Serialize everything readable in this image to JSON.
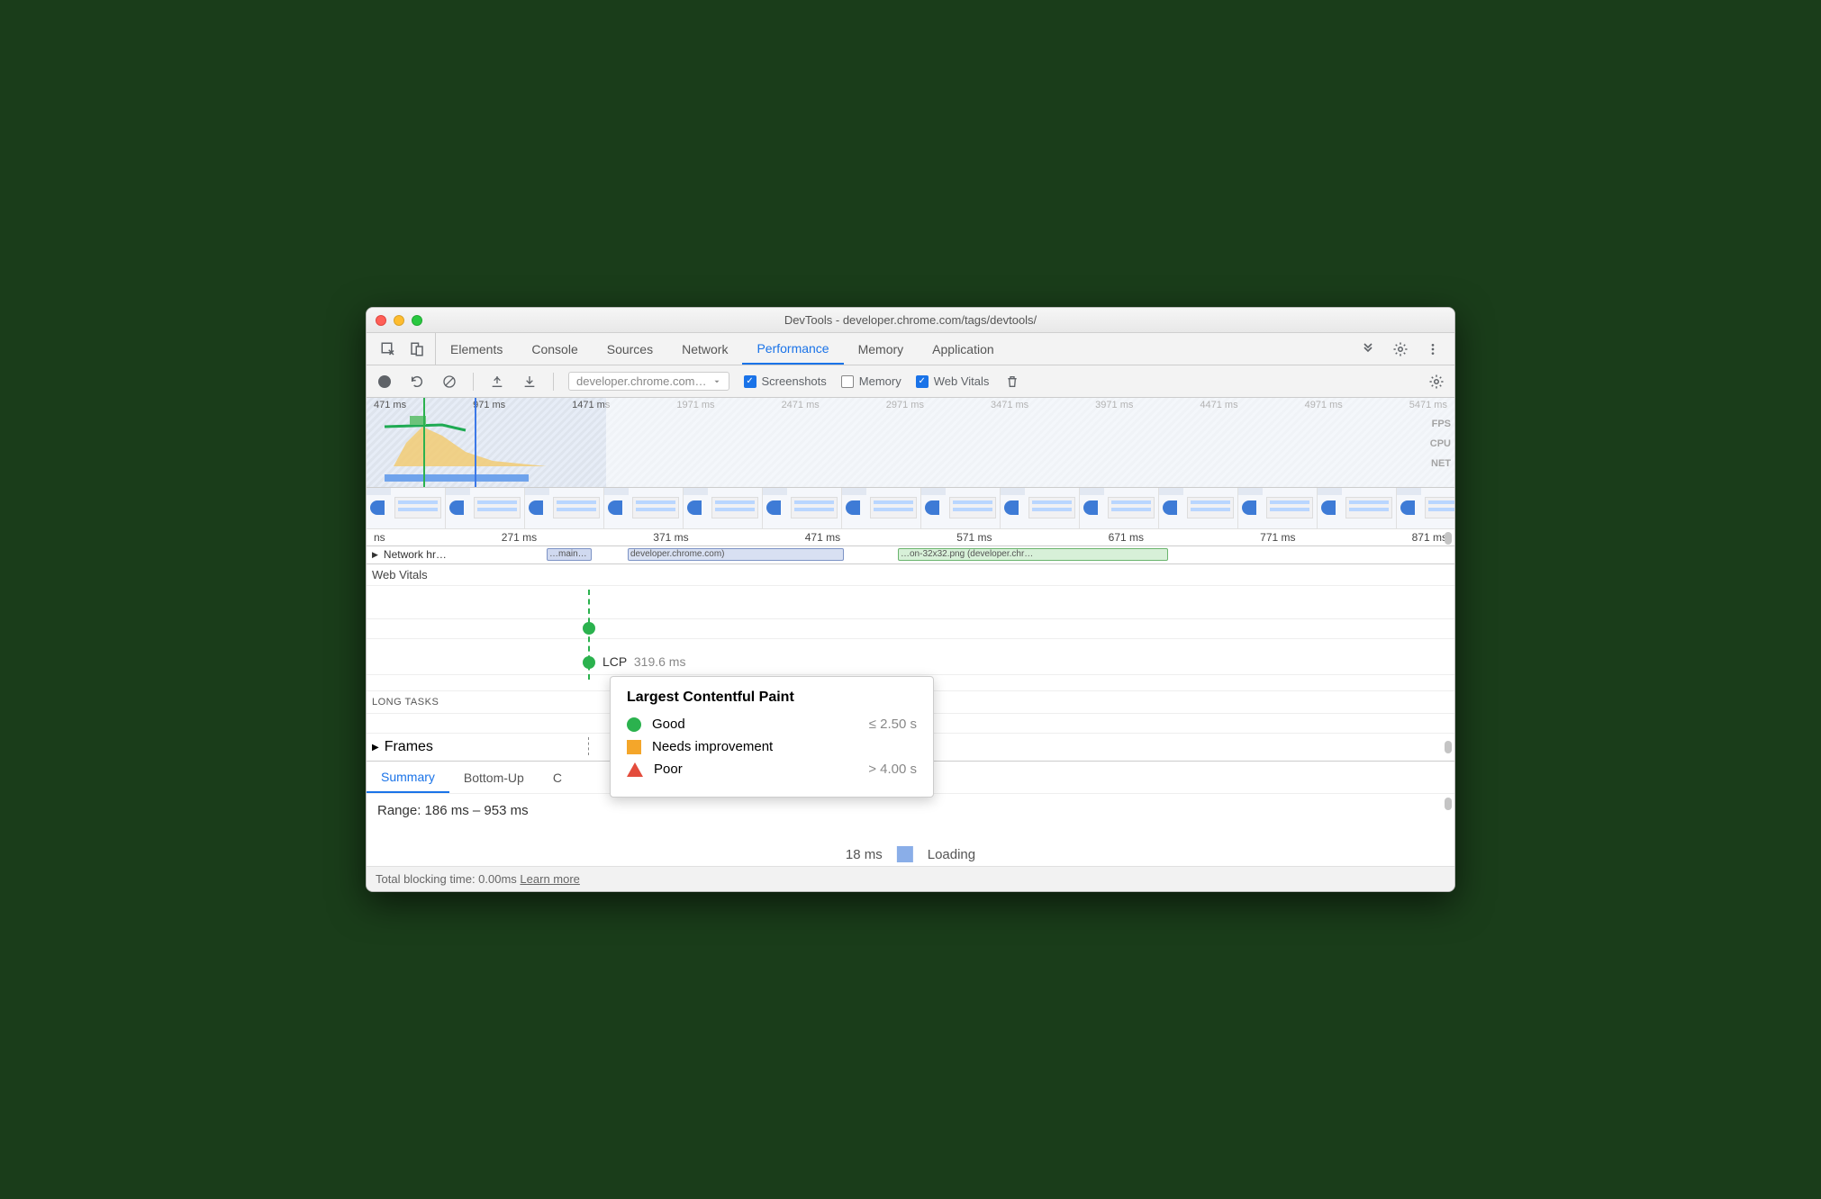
{
  "window": {
    "title": "DevTools - developer.chrome.com/tags/devtools/"
  },
  "tabs": {
    "items": [
      "Elements",
      "Console",
      "Sources",
      "Network",
      "Performance",
      "Memory",
      "Application"
    ],
    "active": "Performance"
  },
  "toolbar": {
    "dropdown": "developer.chrome.com…",
    "screenshots": {
      "label": "Screenshots",
      "checked": true
    },
    "memory": {
      "label": "Memory",
      "checked": false
    },
    "webvitals": {
      "label": "Web Vitals",
      "checked": true
    }
  },
  "overview": {
    "ticks": [
      "471 ms",
      "971 ms",
      "1471 ms",
      "1971 ms",
      "2471 ms",
      "2971 ms",
      "3471 ms",
      "3971 ms",
      "4471 ms",
      "4971 ms",
      "5471 ms"
    ],
    "side": [
      "FPS",
      "CPU",
      "NET"
    ]
  },
  "timeline": {
    "ticks": [
      "ns",
      "271 ms",
      "371 ms",
      "471 ms",
      "571 ms",
      "671 ms",
      "771 ms",
      "871 ms"
    ]
  },
  "tracks": {
    "network": {
      "name": "Network hr…",
      "files_a": "…main…",
      "files_b": "developer.chrome.com)",
      "files_c": "…on-32x32.png (developer.chr…"
    }
  },
  "vitals": {
    "section": "Web Vitals",
    "lcp_name": "LCP",
    "lcp_value": "319.6 ms"
  },
  "tooltip": {
    "title": "Largest Contentful Paint",
    "rows": [
      {
        "label": "Good",
        "threshold": "≤ 2.50 s"
      },
      {
        "label": "Needs improvement",
        "threshold": ""
      },
      {
        "label": "Poor",
        "threshold": "> 4.00 s"
      }
    ]
  },
  "longtasks": {
    "label": "LONG TASKS"
  },
  "frames": {
    "label": "Frames"
  },
  "bottomTabs": {
    "items": [
      "Summary",
      "Bottom-Up"
    ],
    "extra": "C",
    "active": "Summary"
  },
  "summary": {
    "range": "Range: 186 ms – 953 ms",
    "loading_ms": "18 ms",
    "loading": "Loading"
  },
  "footer": {
    "text": "Total blocking time: 0.00ms",
    "link": "Learn more"
  }
}
